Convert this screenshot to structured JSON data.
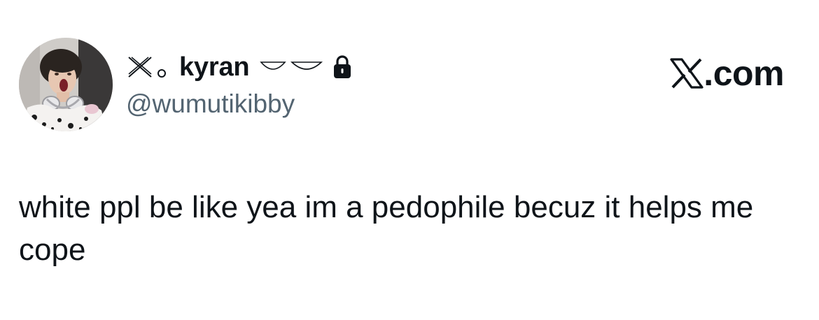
{
  "author": {
    "display_name": "kyran",
    "handle": "@wumutikibby",
    "protected": true,
    "icons": {
      "avatar": "profile-photo",
      "prefix_symbol": "cross-x-icon",
      "prefix_dot": "small-circle-icon",
      "suffix_symbol": "arc-decoration-icon",
      "lock": "lock-icon"
    }
  },
  "brand": {
    "text": ".com",
    "logo": "x-logo-icon"
  },
  "tweet": {
    "text": "white ppl be like yea im a pedophile becuz it helps me cope"
  },
  "colors": {
    "text_primary": "#0f1419",
    "text_secondary": "#536471",
    "background": "#ffffff"
  }
}
